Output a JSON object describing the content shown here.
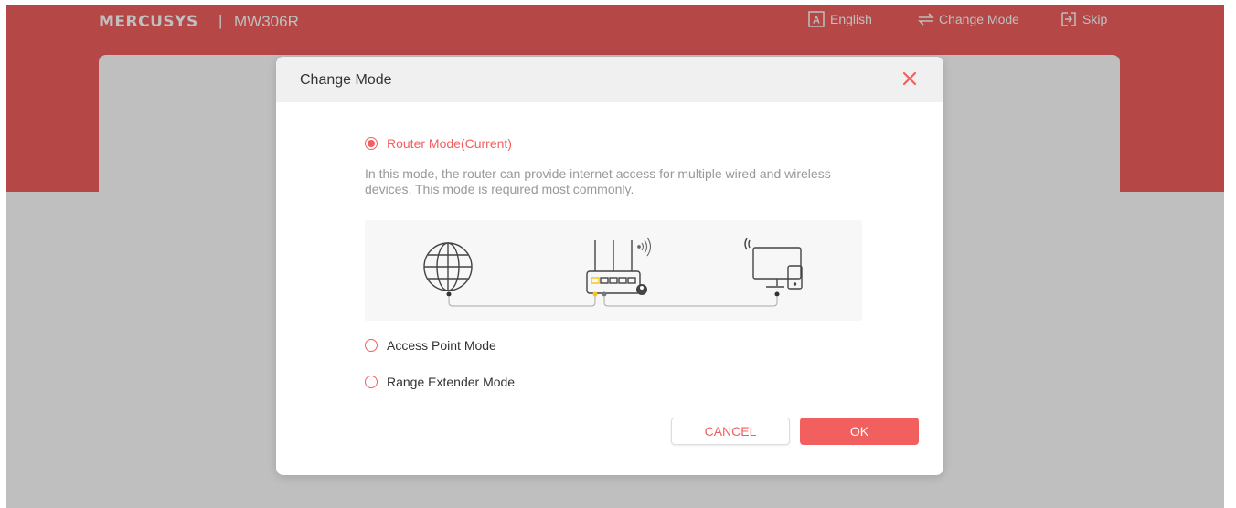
{
  "header": {
    "brand": "MERCUSYS",
    "separator": "|",
    "model": "MW306R",
    "nav": {
      "language_label": "English",
      "change_mode_label": "Change Mode",
      "skip_label": "Skip"
    }
  },
  "dialog": {
    "title": "Change Mode",
    "options": [
      {
        "label": "Router Mode(Current)",
        "selected": true,
        "description": "In this mode, the router can provide internet access for multiple wired and wireless devices. This mode is required most commonly."
      },
      {
        "label": "Access Point Mode",
        "selected": false
      },
      {
        "label": "Range Extender Mode",
        "selected": false
      }
    ],
    "cancel_label": "CANCEL",
    "ok_label": "OK"
  },
  "colors": {
    "accent": "#f25f5f",
    "overlay": "rgba(0,0,0,0.25)",
    "muted_text": "#999999",
    "diagram_bg": "#f7f7f7",
    "port_yellow": "#f5c518"
  },
  "icons": {
    "language": "language-a-icon",
    "change_mode": "swap-arrows-icon",
    "skip": "exit-arrow-icon",
    "close": "close-x-icon",
    "diagram": [
      "globe-icon",
      "router-icon",
      "wifi-signal-icon",
      "monitor-phone-icon"
    ]
  }
}
